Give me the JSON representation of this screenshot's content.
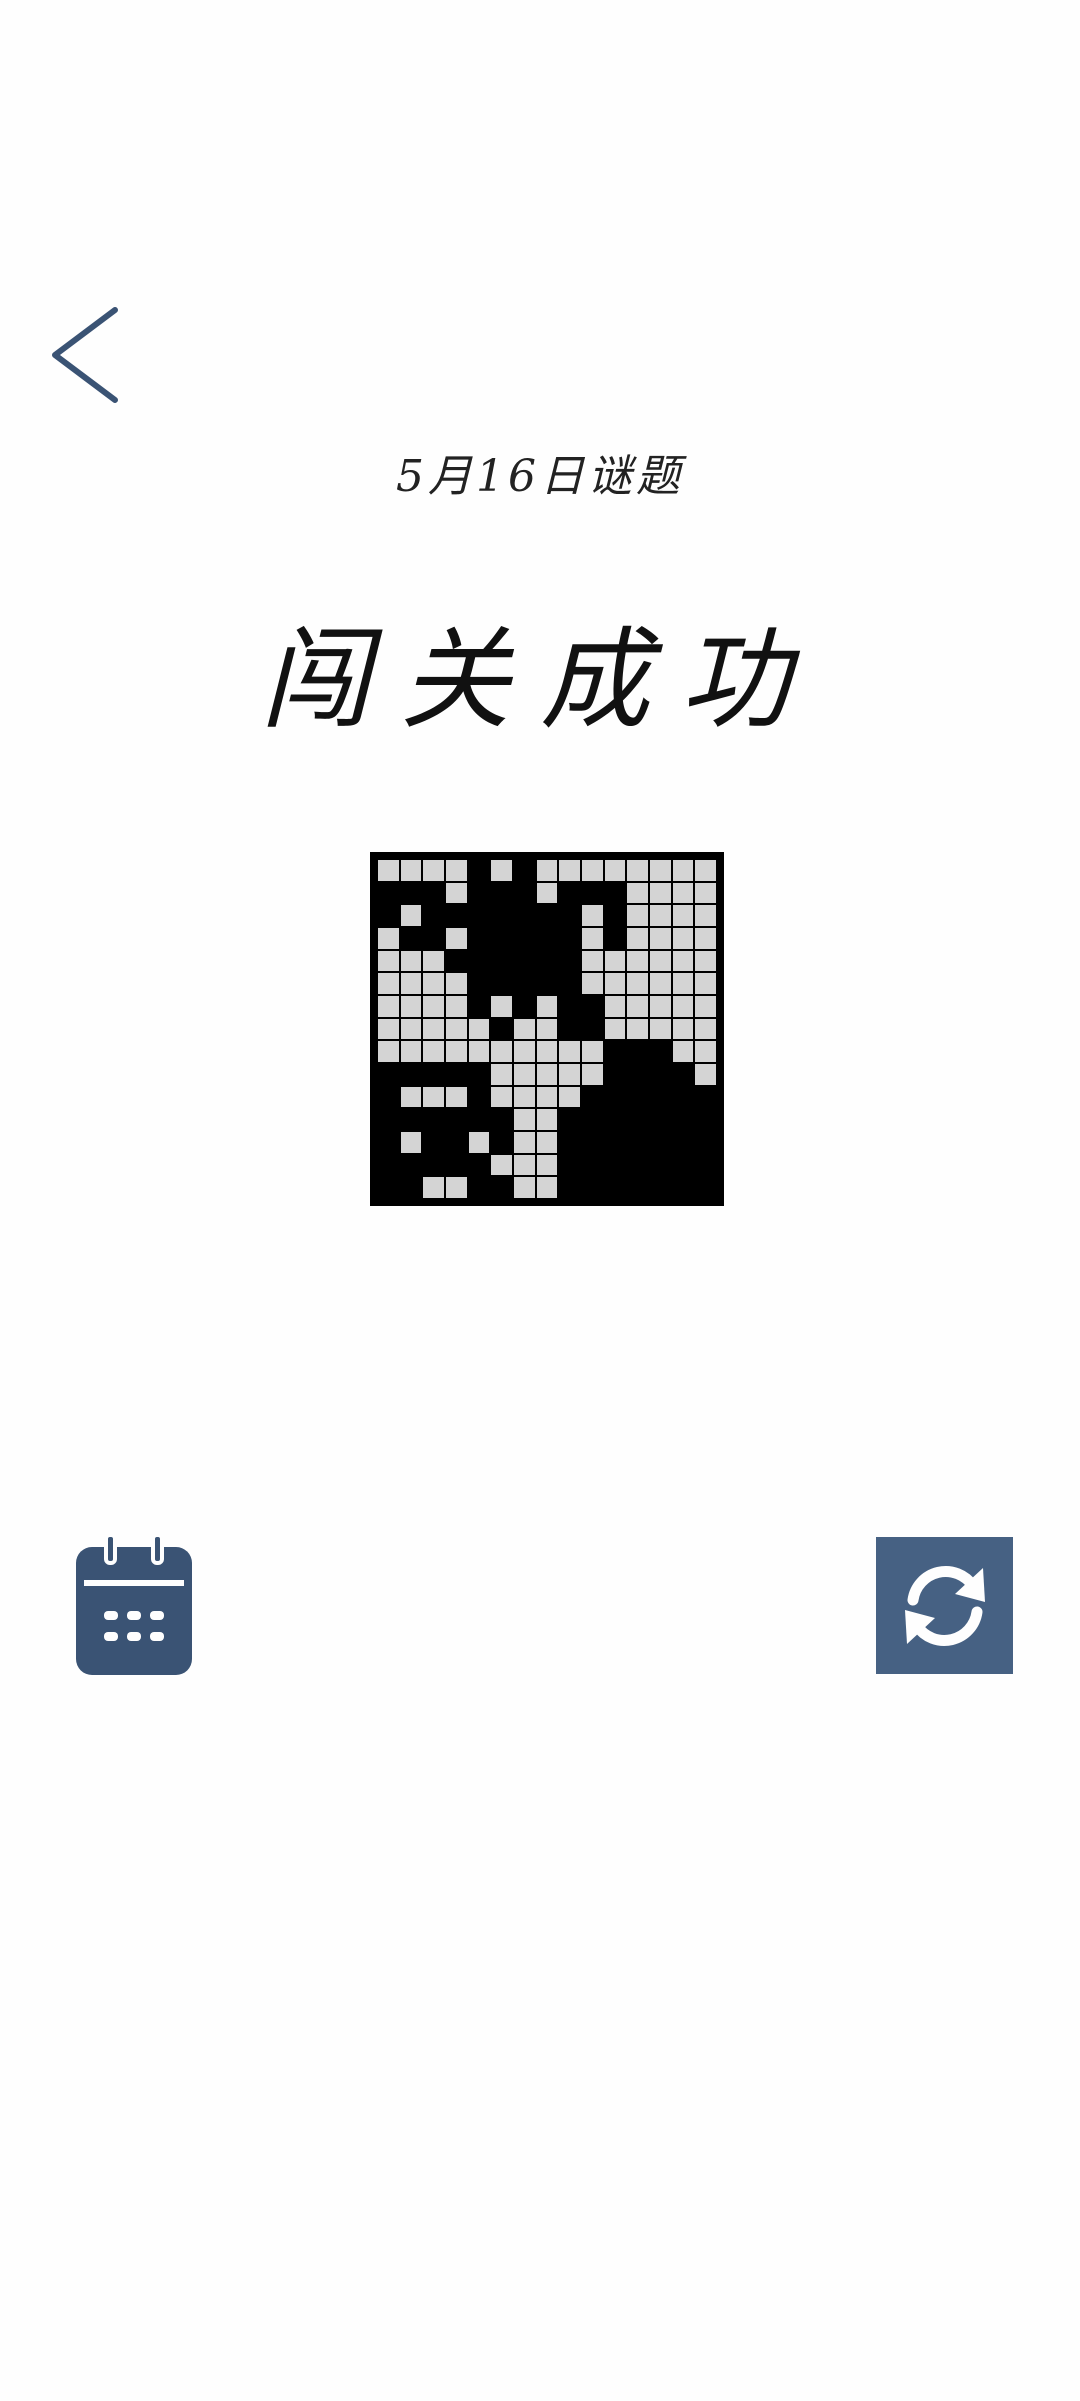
{
  "header": {
    "back_icon": "chevron-left-icon",
    "subtitle": "5月16日谜题",
    "title": "闯关成功"
  },
  "puzzle": {
    "rows": 15,
    "cols": 15,
    "grid": [
      "....#.#........",
      "###.###.###....",
      "#.#######.#....",
      ".##.#####.#....",
      "...######......",
      "....#####......",
      "....#.#.##.....",
      ".....#..##.....",
      "..........###..",
      "#####.....####.",
      "#...#....######",
      "######..#######",
      "#.##.#..#######",
      "#####...#######",
      "##..##..#######"
    ]
  },
  "footer": {
    "calendar_icon": "calendar-icon",
    "refresh_icon": "refresh-icon"
  },
  "colors": {
    "accent": "#466183",
    "calendar": "#3a5374",
    "cell_empty": "#d4d4d4",
    "cell_filled": "#000000"
  }
}
